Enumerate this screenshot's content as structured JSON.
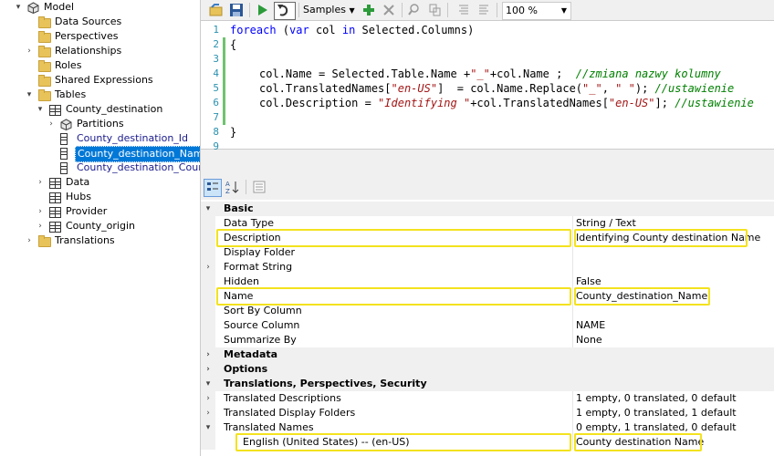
{
  "tree": {
    "items": [
      {
        "label": "Model",
        "expander": "▾",
        "icon": "model-icon",
        "indent": 0
      },
      {
        "label": "Data Sources",
        "expander": "",
        "icon": "folder-icon",
        "indent": 1
      },
      {
        "label": "Perspectives",
        "expander": "",
        "icon": "folder-icon",
        "indent": 1
      },
      {
        "label": "Relationships",
        "expander": "›",
        "icon": "folder-icon",
        "indent": 1
      },
      {
        "label": "Roles",
        "expander": "",
        "icon": "folder-icon",
        "indent": 1
      },
      {
        "label": "Shared Expressions",
        "expander": "",
        "icon": "folder-icon",
        "indent": 1
      },
      {
        "label": "Tables",
        "expander": "▾",
        "icon": "folder-icon",
        "indent": 1
      },
      {
        "label": "County_destination",
        "expander": "▾",
        "icon": "table-icon",
        "indent": 2
      },
      {
        "label": "Partitions",
        "expander": "›",
        "icon": "partitions-icon",
        "indent": 3
      },
      {
        "label": "County_destination_Id",
        "expander": "",
        "icon": "column-icon",
        "indent": 3
      },
      {
        "label": "County_destination_Name",
        "expander": "",
        "icon": "column-icon",
        "indent": 3,
        "selected": true
      },
      {
        "label": "County_destination_Country",
        "expander": "",
        "icon": "column-icon",
        "indent": 3
      },
      {
        "label": "Data",
        "expander": "›",
        "icon": "table-icon",
        "indent": 2
      },
      {
        "label": "Hubs",
        "expander": "",
        "icon": "table-icon",
        "indent": 2
      },
      {
        "label": "Provider",
        "expander": "›",
        "icon": "table-icon",
        "indent": 2
      },
      {
        "label": "County_origin",
        "expander": "›",
        "icon": "table-icon",
        "indent": 2
      },
      {
        "label": "Translations",
        "expander": "›",
        "icon": "folder-icon",
        "indent": 1
      }
    ]
  },
  "toolbar": {
    "samples_label": "Samples",
    "zoom_value": "100 %"
  },
  "editor": {
    "line_numbers": [
      "1",
      "2",
      "3",
      "4",
      "5",
      "6",
      "7",
      "8",
      "9"
    ],
    "line1": {
      "kw1": "foreach",
      "p1": " (",
      "kw2": "var",
      "p2": " col ",
      "kw3": "in",
      "p3": " Selected.Columns)"
    },
    "line2": "{",
    "line4": {
      "a": "col.Name = Selected.Table.Name +",
      "s1": "\"_\"",
      "b": "+col.Name ;  ",
      "c": "//zmiana nazwy kolumny"
    },
    "line5": {
      "a": "col.TranslatedNames[",
      "s1": "\"en-US\"",
      "b": "]  = col.Name.Replace(",
      "s2": "\"_\"",
      "b2": ", ",
      "s3": "\" \"",
      "b3": "); ",
      "c": "//ustawienie"
    },
    "line6": {
      "a": "col.Description = ",
      "s1": "\"Identifying \"",
      "b": "+col.TranslatedNames[",
      "s2": "\"en-US\"",
      "b2": "]; ",
      "c": "//ustawienie"
    },
    "line8": "}"
  },
  "properties": {
    "rows": [
      {
        "type": "cat",
        "glyph": "▾",
        "name": "Basic",
        "value": ""
      },
      {
        "type": "prop",
        "glyph": "",
        "name": "Data Type",
        "value": "String / Text"
      },
      {
        "type": "prop",
        "glyph": "",
        "name": "Description",
        "value": "Identifying County destination Name"
      },
      {
        "type": "prop",
        "glyph": "",
        "name": "Display Folder",
        "value": ""
      },
      {
        "type": "prop",
        "glyph": "›",
        "name": "Format String",
        "value": ""
      },
      {
        "type": "prop",
        "glyph": "",
        "name": "Hidden",
        "value": "False"
      },
      {
        "type": "prop",
        "glyph": "",
        "name": "Name",
        "value": "County_destination_Name"
      },
      {
        "type": "prop",
        "glyph": "",
        "name": "Sort By Column",
        "value": ""
      },
      {
        "type": "prop",
        "glyph": "",
        "name": "Source Column",
        "value": "NAME"
      },
      {
        "type": "prop",
        "glyph": "",
        "name": "Summarize By",
        "value": "None"
      },
      {
        "type": "cat",
        "glyph": "›",
        "name": "Metadata",
        "value": ""
      },
      {
        "type": "cat",
        "glyph": "›",
        "name": "Options",
        "value": ""
      },
      {
        "type": "cat",
        "glyph": "▾",
        "name": "Translations, Perspectives, Security",
        "value": ""
      },
      {
        "type": "prop",
        "glyph": "›",
        "name": "Translated Descriptions",
        "value": "1 empty, 0 translated, 0 default"
      },
      {
        "type": "prop",
        "glyph": "›",
        "name": "Translated Display Folders",
        "value": "1 empty, 0 translated, 1 default"
      },
      {
        "type": "prop",
        "glyph": "▾",
        "name": "Translated Names",
        "value": "0 empty, 1 translated, 0 default"
      },
      {
        "type": "sub",
        "glyph": "",
        "name": "English (United States) -- (en-US)",
        "value": "County destination Name"
      }
    ]
  },
  "colors": {
    "selection": "#0078d7",
    "highlight": "#f3e21f",
    "keyword": "#0000ff",
    "string": "#a31515",
    "comment": "#008000"
  }
}
